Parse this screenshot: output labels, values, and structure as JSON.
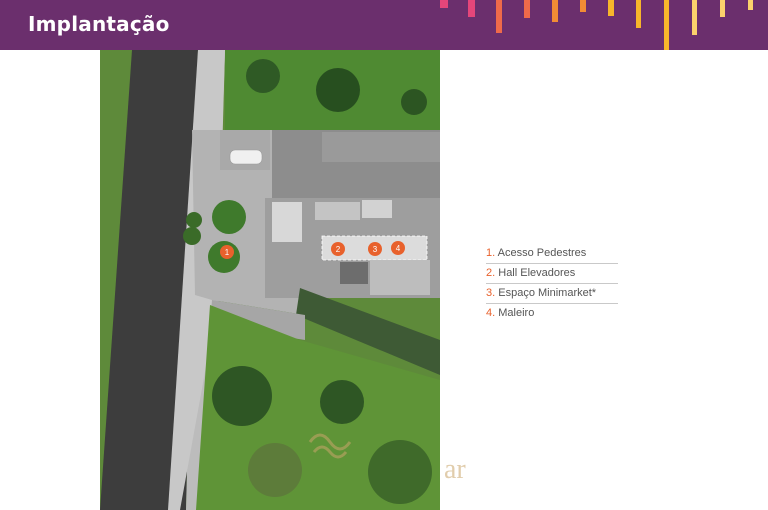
{
  "header": {
    "title": "Implantação",
    "background": "#6b2f6d",
    "bar_colors": [
      "#e5467a",
      "#ef6a4a",
      "#f28c35",
      "#f7b52b",
      "#fbd16c"
    ]
  },
  "site_plan": {
    "markers": [
      {
        "number": "1",
        "feature": "Acesso Pedestres"
      },
      {
        "number": "2",
        "feature": "Hall Elevadores"
      },
      {
        "number": "3",
        "feature": "Espaço Minimarket"
      },
      {
        "number": "4",
        "feature": "Maleiro"
      }
    ],
    "marker_color": "#e8612c",
    "watermark": "ar"
  },
  "legend": {
    "items": [
      {
        "num": "1.",
        "text": " Acesso Pedestres"
      },
      {
        "num": "2.",
        "text": " Hall Elevadores"
      },
      {
        "num": "3.",
        "text": " Espaço Minimarket*"
      },
      {
        "num": "4.",
        "text": " Maleiro"
      }
    ]
  }
}
